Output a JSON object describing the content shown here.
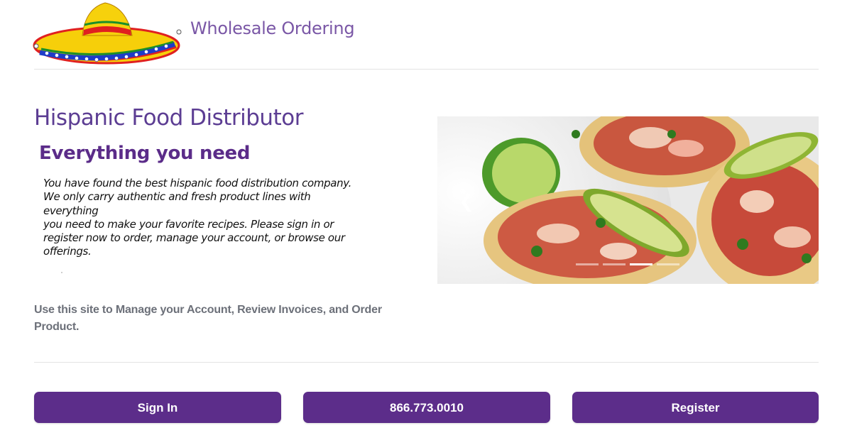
{
  "header": {
    "title": "Wholesale Ordering",
    "logo_icon": "sombrero-icon"
  },
  "main": {
    "company_name": "Hispanic Food Distributor",
    "tagline": "Everything you need",
    "intro_lines": [
      "You have found the best hispanic food distribution company.",
      "We only carry authentic and fresh product lines with everything",
      "you need to make your favorite recipes.  Please sign in or",
      "register now to order, manage your account, or browse our",
      "offerings."
    ],
    "site_use_lines": [
      "Use this site to Manage your Account, Review Invoices, and Order",
      "Product."
    ]
  },
  "carousel": {
    "image_subject": "tostadas-photo",
    "prev_icon": "chevron-left-icon",
    "slide_count": 4,
    "active_slide": 3
  },
  "actions": {
    "sign_in_label": "Sign In",
    "phone_label": "866.773.0010",
    "register_label": "Register"
  },
  "colors": {
    "brand_purple": "#5c2d8a",
    "title_purple": "#7a57a6",
    "muted_text": "#6c7079"
  }
}
